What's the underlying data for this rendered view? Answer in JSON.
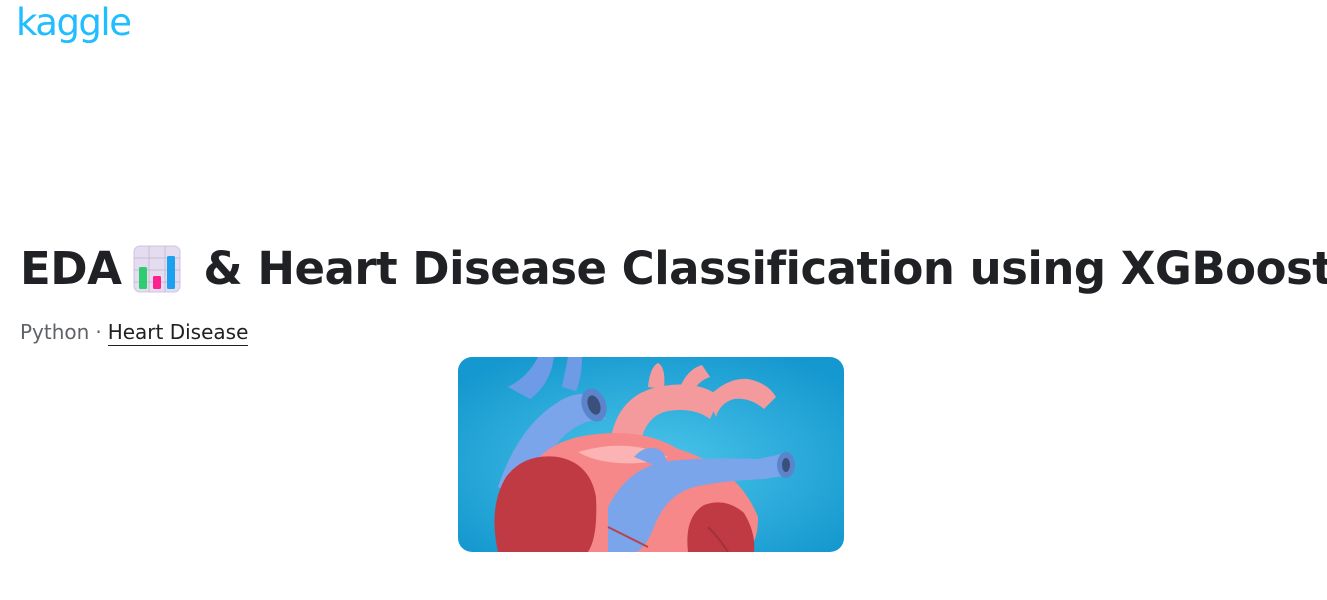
{
  "header": {
    "logo_text": "kaggle",
    "logo_color": "#20beff"
  },
  "notebook": {
    "title_prefix": "EDA",
    "title_icon": "bar-chart-emoji-icon",
    "title_suffix": "& Heart Disease Classification using XGBoost",
    "language": "Python",
    "separator": "·",
    "dataset_link": "Heart Disease"
  },
  "hero_image": {
    "subject": "heart-illustration",
    "background_color": "#1aa7d8"
  }
}
